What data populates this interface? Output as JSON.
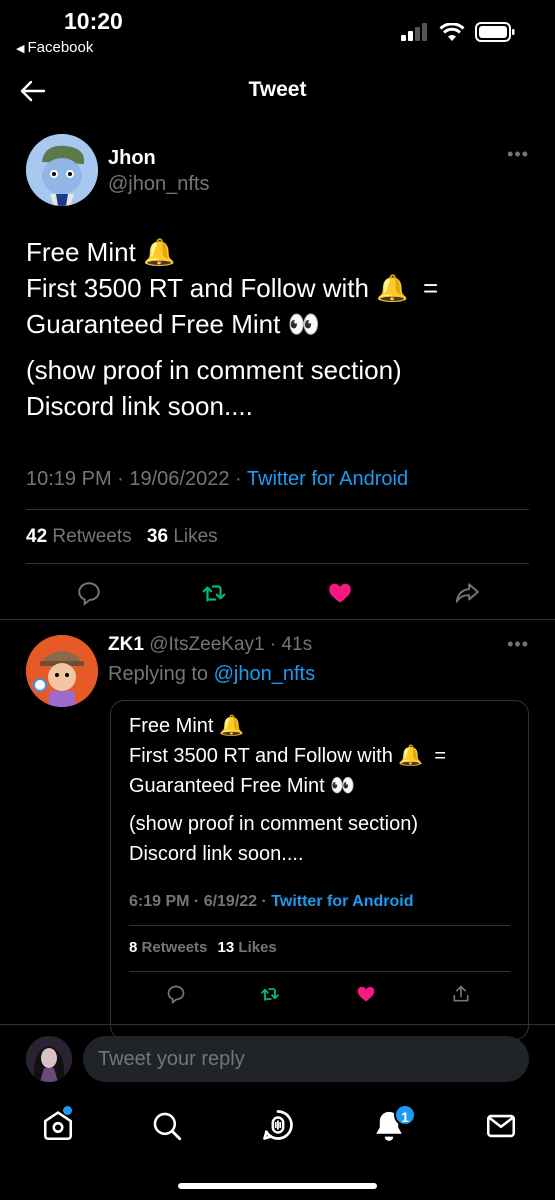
{
  "status": {
    "time": "10:20",
    "back_app": "Facebook"
  },
  "header": {
    "title": "Tweet"
  },
  "tweet": {
    "display_name": "Jhon",
    "handle": "@jhon_nfts",
    "text_lines": [
      "Free Mint 🔔",
      "First 3500 RT and Follow with 🔔  =",
      "Guaranteed Free Mint 👀"
    ],
    "text_lines_2": [
      "(show proof in comment section)",
      "Discord link soon...."
    ],
    "time": "10:19 PM · 19/06/2022 · ",
    "source": "Twitter for Android",
    "retweets": "42",
    "retweets_label": "Retweets",
    "likes": "36",
    "likes_label": "Likes"
  },
  "reply": {
    "display_name": "ZK1",
    "handle_time": "@ItsZeeKay1 · 41s",
    "replying_label": "Replying to ",
    "replying_to": "@jhon_nfts"
  },
  "quote": {
    "text_lines": [
      "Free Mint 🔔",
      "First 3500 RT and Follow with 🔔  =",
      "Guaranteed Free Mint 👀"
    ],
    "text_lines_2": [
      "(show proof in comment section)",
      "Discord link soon...."
    ],
    "time": "6:19 PM · 6/19/22 · ",
    "source": "Twitter for Android",
    "retweets": "8",
    "retweets_label": "Retweets",
    "likes": "13",
    "likes_label": "Likes"
  },
  "composer": {
    "placeholder": "Tweet your reply"
  },
  "tabbar": {
    "notification_count": "1"
  },
  "colors": {
    "accent": "#1d9bf0",
    "like": "#f91880",
    "retweet": "#00ba7c",
    "muted": "#71767b"
  },
  "icons": [
    "back-arrow-icon",
    "reply-icon",
    "retweet-icon",
    "heart-icon",
    "share-icon",
    "home-icon",
    "search-icon",
    "spaces-icon",
    "bell-icon",
    "mail-icon"
  ]
}
